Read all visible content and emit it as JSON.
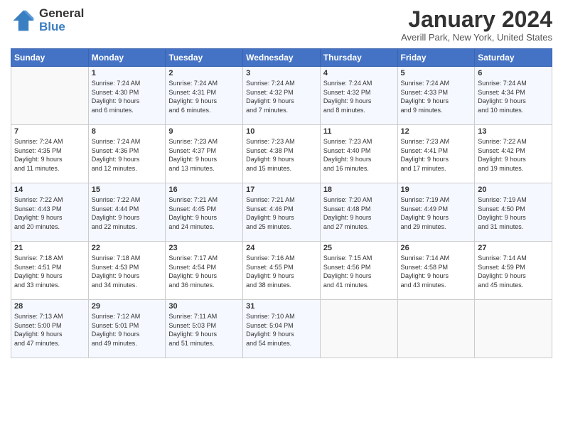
{
  "logo": {
    "general": "General",
    "blue": "Blue"
  },
  "title": "January 2024",
  "location": "Averill Park, New York, United States",
  "days_header": [
    "Sunday",
    "Monday",
    "Tuesday",
    "Wednesday",
    "Thursday",
    "Friday",
    "Saturday"
  ],
  "weeks": [
    [
      {
        "num": "",
        "info": ""
      },
      {
        "num": "1",
        "info": "Sunrise: 7:24 AM\nSunset: 4:30 PM\nDaylight: 9 hours\nand 6 minutes."
      },
      {
        "num": "2",
        "info": "Sunrise: 7:24 AM\nSunset: 4:31 PM\nDaylight: 9 hours\nand 6 minutes."
      },
      {
        "num": "3",
        "info": "Sunrise: 7:24 AM\nSunset: 4:32 PM\nDaylight: 9 hours\nand 7 minutes."
      },
      {
        "num": "4",
        "info": "Sunrise: 7:24 AM\nSunset: 4:32 PM\nDaylight: 9 hours\nand 8 minutes."
      },
      {
        "num": "5",
        "info": "Sunrise: 7:24 AM\nSunset: 4:33 PM\nDaylight: 9 hours\nand 9 minutes."
      },
      {
        "num": "6",
        "info": "Sunrise: 7:24 AM\nSunset: 4:34 PM\nDaylight: 9 hours\nand 10 minutes."
      }
    ],
    [
      {
        "num": "7",
        "info": "Sunrise: 7:24 AM\nSunset: 4:35 PM\nDaylight: 9 hours\nand 11 minutes."
      },
      {
        "num": "8",
        "info": "Sunrise: 7:24 AM\nSunset: 4:36 PM\nDaylight: 9 hours\nand 12 minutes."
      },
      {
        "num": "9",
        "info": "Sunrise: 7:23 AM\nSunset: 4:37 PM\nDaylight: 9 hours\nand 13 minutes."
      },
      {
        "num": "10",
        "info": "Sunrise: 7:23 AM\nSunset: 4:38 PM\nDaylight: 9 hours\nand 15 minutes."
      },
      {
        "num": "11",
        "info": "Sunrise: 7:23 AM\nSunset: 4:40 PM\nDaylight: 9 hours\nand 16 minutes."
      },
      {
        "num": "12",
        "info": "Sunrise: 7:23 AM\nSunset: 4:41 PM\nDaylight: 9 hours\nand 17 minutes."
      },
      {
        "num": "13",
        "info": "Sunrise: 7:22 AM\nSunset: 4:42 PM\nDaylight: 9 hours\nand 19 minutes."
      }
    ],
    [
      {
        "num": "14",
        "info": "Sunrise: 7:22 AM\nSunset: 4:43 PM\nDaylight: 9 hours\nand 20 minutes."
      },
      {
        "num": "15",
        "info": "Sunrise: 7:22 AM\nSunset: 4:44 PM\nDaylight: 9 hours\nand 22 minutes."
      },
      {
        "num": "16",
        "info": "Sunrise: 7:21 AM\nSunset: 4:45 PM\nDaylight: 9 hours\nand 24 minutes."
      },
      {
        "num": "17",
        "info": "Sunrise: 7:21 AM\nSunset: 4:46 PM\nDaylight: 9 hours\nand 25 minutes."
      },
      {
        "num": "18",
        "info": "Sunrise: 7:20 AM\nSunset: 4:48 PM\nDaylight: 9 hours\nand 27 minutes."
      },
      {
        "num": "19",
        "info": "Sunrise: 7:19 AM\nSunset: 4:49 PM\nDaylight: 9 hours\nand 29 minutes."
      },
      {
        "num": "20",
        "info": "Sunrise: 7:19 AM\nSunset: 4:50 PM\nDaylight: 9 hours\nand 31 minutes."
      }
    ],
    [
      {
        "num": "21",
        "info": "Sunrise: 7:18 AM\nSunset: 4:51 PM\nDaylight: 9 hours\nand 33 minutes."
      },
      {
        "num": "22",
        "info": "Sunrise: 7:18 AM\nSunset: 4:53 PM\nDaylight: 9 hours\nand 34 minutes."
      },
      {
        "num": "23",
        "info": "Sunrise: 7:17 AM\nSunset: 4:54 PM\nDaylight: 9 hours\nand 36 minutes."
      },
      {
        "num": "24",
        "info": "Sunrise: 7:16 AM\nSunset: 4:55 PM\nDaylight: 9 hours\nand 38 minutes."
      },
      {
        "num": "25",
        "info": "Sunrise: 7:15 AM\nSunset: 4:56 PM\nDaylight: 9 hours\nand 41 minutes."
      },
      {
        "num": "26",
        "info": "Sunrise: 7:14 AM\nSunset: 4:58 PM\nDaylight: 9 hours\nand 43 minutes."
      },
      {
        "num": "27",
        "info": "Sunrise: 7:14 AM\nSunset: 4:59 PM\nDaylight: 9 hours\nand 45 minutes."
      }
    ],
    [
      {
        "num": "28",
        "info": "Sunrise: 7:13 AM\nSunset: 5:00 PM\nDaylight: 9 hours\nand 47 minutes."
      },
      {
        "num": "29",
        "info": "Sunrise: 7:12 AM\nSunset: 5:01 PM\nDaylight: 9 hours\nand 49 minutes."
      },
      {
        "num": "30",
        "info": "Sunrise: 7:11 AM\nSunset: 5:03 PM\nDaylight: 9 hours\nand 51 minutes."
      },
      {
        "num": "31",
        "info": "Sunrise: 7:10 AM\nSunset: 5:04 PM\nDaylight: 9 hours\nand 54 minutes."
      },
      {
        "num": "",
        "info": ""
      },
      {
        "num": "",
        "info": ""
      },
      {
        "num": "",
        "info": ""
      }
    ]
  ]
}
